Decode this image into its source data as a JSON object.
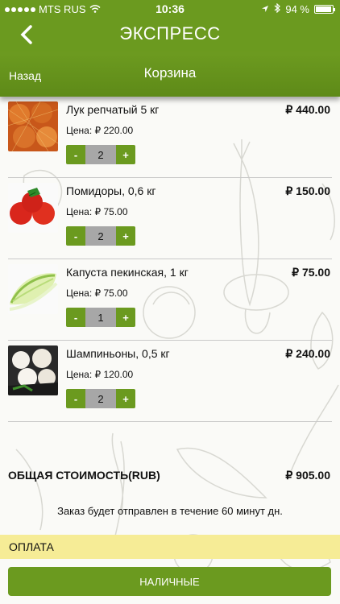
{
  "status_bar": {
    "carrier": "MTS RUS",
    "time": "10:36",
    "battery": "94 %",
    "battery_level": 0.94
  },
  "nav": {
    "title": "ЭКСПРЕСС"
  },
  "sub_header": {
    "back_label": "Назад",
    "title": "Корзина"
  },
  "cart": {
    "items": [
      {
        "name": "Лук репчатый 5 кг",
        "total": "₽ 440.00",
        "unit_price": "Цена: ₽ 220.00",
        "quantity": "2",
        "minus": "-",
        "plus": "+"
      },
      {
        "name": "Помидоры, 0,6 кг",
        "total": "₽ 150.00",
        "unit_price": "Цена: ₽ 75.00",
        "quantity": "2",
        "minus": "-",
        "plus": "+"
      },
      {
        "name": "Капуста пекинская, 1 кг",
        "total": "₽ 75.00",
        "unit_price": "Цена: ₽ 75.00",
        "quantity": "1",
        "minus": "-",
        "plus": "+"
      },
      {
        "name": "Шампиньоны, 0,5 кг",
        "total": "₽ 240.00",
        "unit_price": "Цена: ₽ 120.00",
        "quantity": "2",
        "minus": "-",
        "plus": "+"
      }
    ]
  },
  "summary": {
    "total_label": "ОБЩАЯ СТОИМОСТЬ(RUB)",
    "total_value": "₽ 905.00",
    "delivery_notice": "Заказ будет отправлен в течение 60 минут дн."
  },
  "payment": {
    "header": "ОПЛАТА",
    "cash_button": "НАЛИЧНЫЕ"
  },
  "colors": {
    "accent": "#6b9a1f",
    "payment_header": "#f6ec96",
    "stepper_qty": "#a7a7a7"
  }
}
